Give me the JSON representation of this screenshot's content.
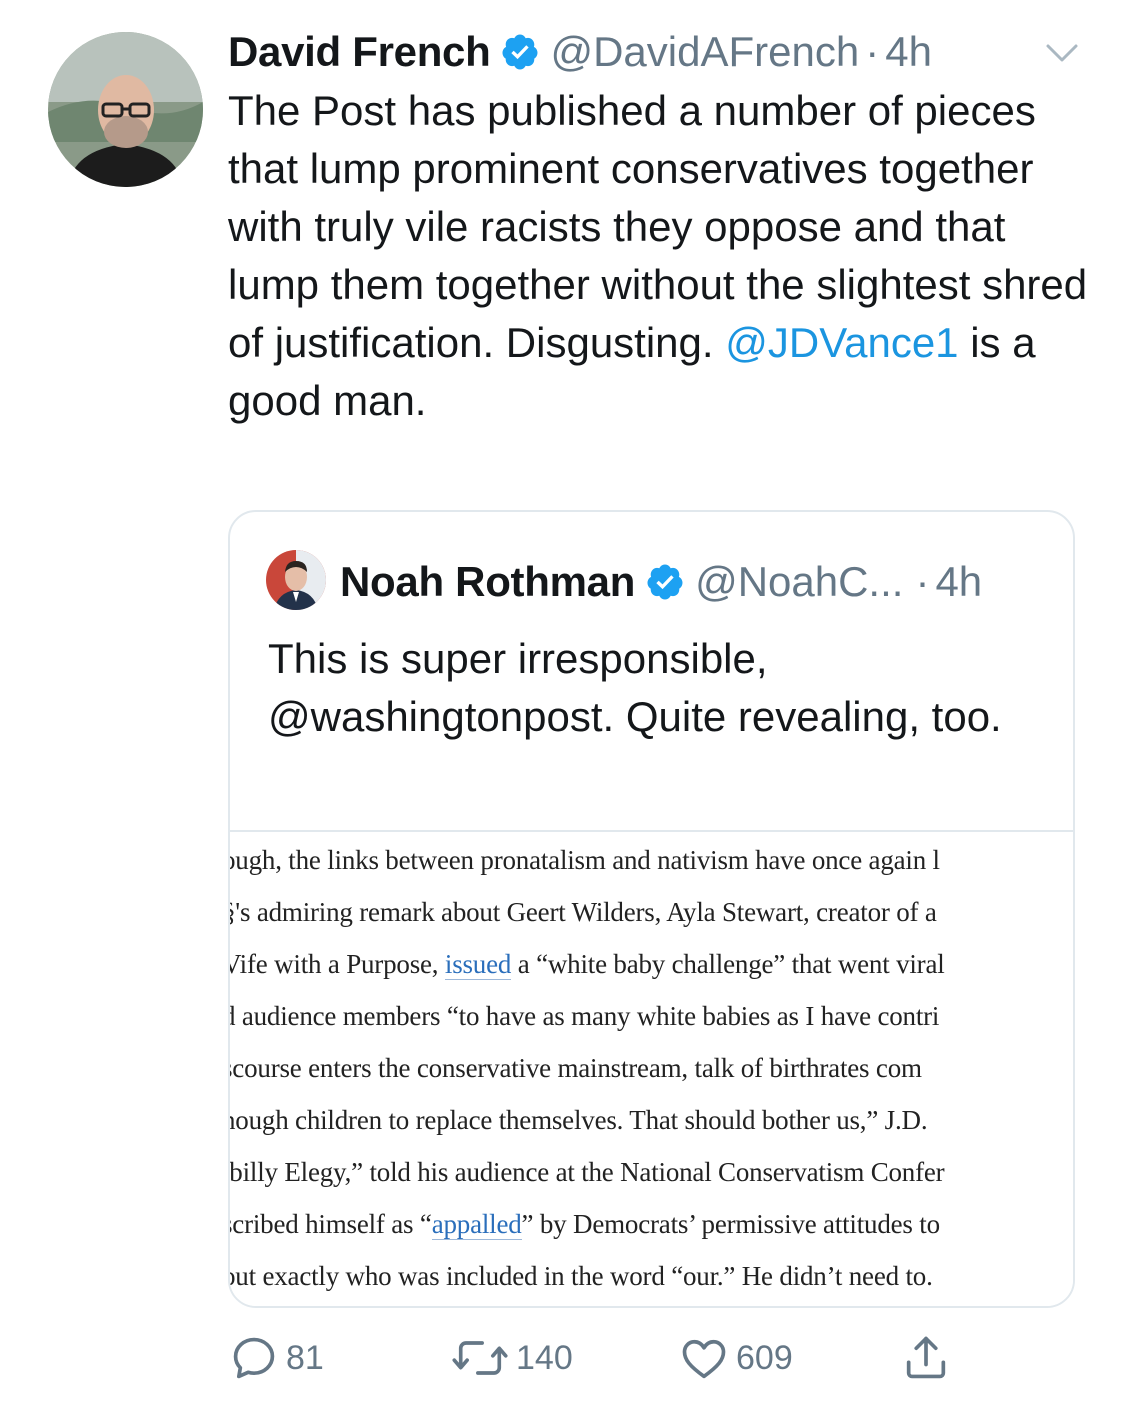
{
  "tweet": {
    "author_name": "David French",
    "handle": "@DavidAFrench",
    "separator": "·",
    "time": "4h",
    "text_before": "The Post has published a number of pieces that lump prominent conservatives together with truly vile racists they oppose and that lump them together without the slightest shred of justification. Disgusting. ",
    "mention": "@JDVance1",
    "text_after": " is a good man.",
    "icons": {
      "verified": "verified-badge-icon",
      "menu": "chevron-down-icon"
    },
    "colors": {
      "link": "#1b95e0",
      "verified": "#1da1f2",
      "secondary": "#657786"
    }
  },
  "quote": {
    "author_name": "Noah Rothman",
    "handle": "@NoahC...",
    "separator": "·",
    "time": "4h",
    "text": "This is super irresponsible, @washingtonpost. Quite revealing, too.",
    "image_lines": [
      {
        "parts": [
          {
            "t": "ough, the links between pronatalism and nativism have once again l"
          }
        ]
      },
      {
        "parts": [
          {
            "t": "§'s admiring remark about Geert Wilders, Ayla Stewart, creator of a"
          }
        ]
      },
      {
        "parts": [
          {
            "t": "Vife with a Purpose, "
          },
          {
            "t": "issued",
            "link": true
          },
          {
            "t": " a “white baby challenge” that went viral"
          }
        ]
      },
      {
        "parts": [
          {
            "t": "d audience members “to have as many white babies as I have contri"
          }
        ]
      },
      {
        "parts": [
          {
            "t": "scourse enters the conservative mainstream, talk of birthrates com"
          }
        ]
      },
      {
        "parts": [
          {
            "t": "nough children to replace themselves. That should bother us,” J.D."
          }
        ]
      },
      {
        "parts": [
          {
            "t": "lbilly Elegy,” told his audience at the National Conservatism Confer"
          }
        ]
      },
      {
        "parts": [
          {
            "t": "scribed himself as “"
          },
          {
            "t": "appalled",
            "link": true
          },
          {
            "t": "” by Democrats’ permissive attitudes to"
          }
        ]
      },
      {
        "parts": [
          {
            "t": "out exactly who was included in the word “our.” He didn’t need to."
          }
        ]
      }
    ]
  },
  "actions": {
    "reply": {
      "icon": "reply-icon",
      "count": "81"
    },
    "retweet": {
      "icon": "retweet-icon",
      "count": "140"
    },
    "like": {
      "icon": "heart-icon",
      "count": "609"
    },
    "share": {
      "icon": "share-icon"
    }
  }
}
